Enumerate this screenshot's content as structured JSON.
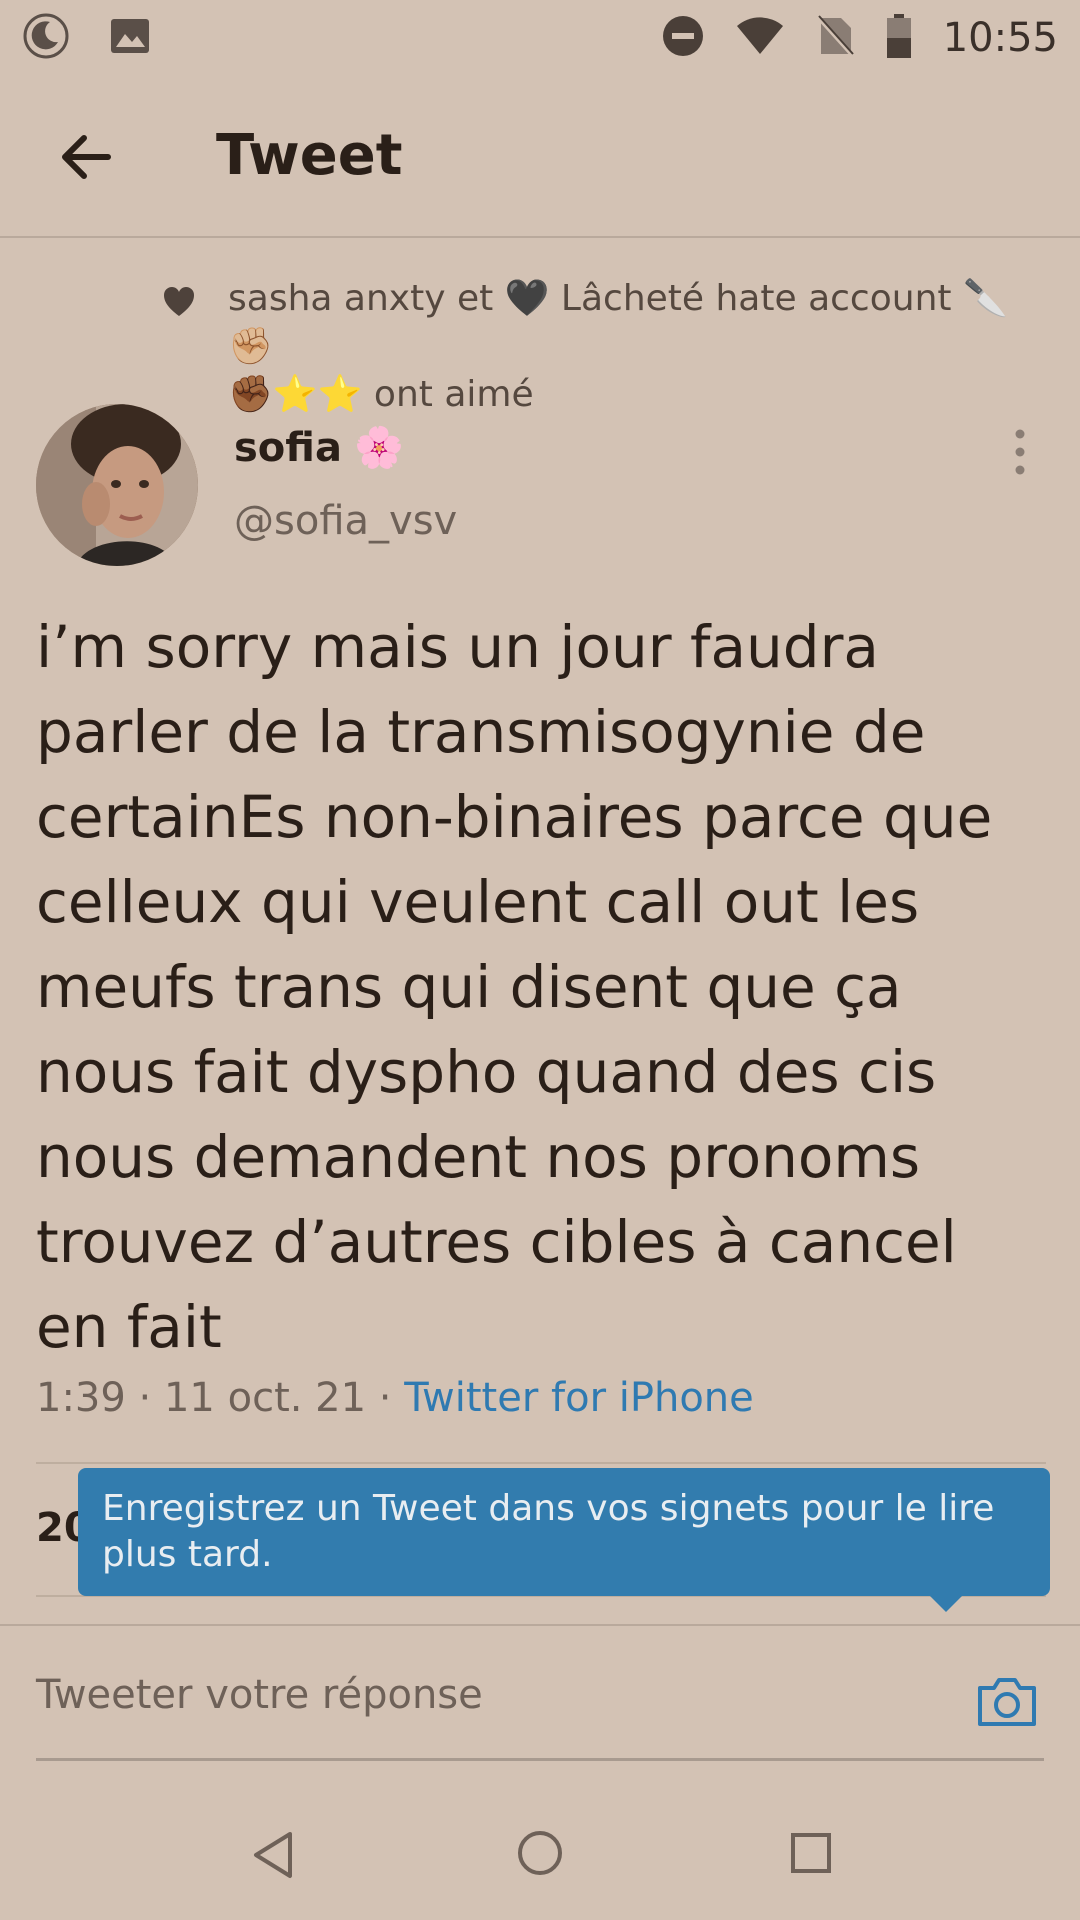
{
  "status_bar": {
    "time": "10:55",
    "left_icons": [
      "moon-icon",
      "image-icon"
    ],
    "right_icons": [
      "do-not-disturb-icon",
      "wifi-icon",
      "no-sim-icon",
      "battery-icon"
    ]
  },
  "header": {
    "title": "Tweet",
    "back_icon": "arrow-left-icon"
  },
  "liked_by": {
    "line1": "sasha anxty et 🖤 Lâcheté hate account 🔪 ✊🏼",
    "line2": "✊🏾⭐⭐ ont aimé"
  },
  "author": {
    "display_name": "sofia",
    "name_emoji": "🌸",
    "handle": "@sofia_vsv"
  },
  "tweet": {
    "text": "i’m sorry mais un jour faudra\nparler de la transmisogynie  de\ncertainEs non-binaires parce que\ncelleux qui veulent call out les\nmeufs trans qui disent que ça\nnous fait dyspho quand des cis\nnous demandent nos pronoms\ntrouvez d’autres cibles à cancel\nen fait",
    "time": "1:39",
    "date": "11 oct. 21",
    "source": "Twitter for iPhone"
  },
  "stats": {
    "partial": "20"
  },
  "tooltip": {
    "text": "Enregistrez un Tweet dans vos signets pour le lire plus tard."
  },
  "reply": {
    "placeholder": "Tweeter votre réponse",
    "camera_icon": "camera-icon"
  },
  "nav": {
    "icons": [
      "nav-back-icon",
      "nav-home-icon",
      "nav-recent-icon"
    ]
  },
  "colors": {
    "background": "#d3c2b4",
    "accent": "#2f7ab1",
    "tooltip": "#327cae"
  }
}
